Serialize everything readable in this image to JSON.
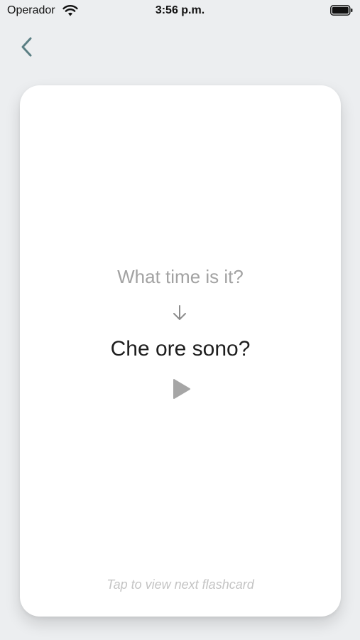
{
  "status_bar": {
    "carrier": "Operador",
    "time": "3:56 p.m.",
    "icons": [
      "wifi-icon",
      "battery-icon"
    ]
  },
  "nav": {
    "back_icon": "chevron-left-icon",
    "accent_color": "#5b7f84"
  },
  "flashcard": {
    "prompt": "What time is it?",
    "direction_icon": "arrow-down-icon",
    "answer": "Che ore sono?",
    "play_icon": "play-icon",
    "hint": "Tap to view next flashcard"
  }
}
